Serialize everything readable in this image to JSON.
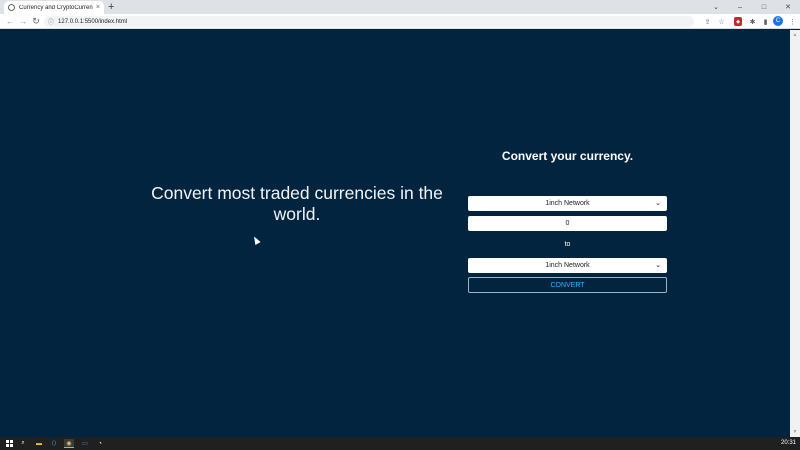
{
  "browser": {
    "tab_title": "Currency and CryptoCurrency Ex",
    "tab_close": "×",
    "new_tab": "+",
    "url": "127.0.0.1:5500/index.html",
    "lock_glyph": "ⓘ",
    "window_controls": {
      "minimize": "–",
      "maximize": "□",
      "close": "✕",
      "dropdown": "⌄"
    },
    "nav": {
      "back": "←",
      "forward": "→",
      "reload": "↻"
    },
    "toolbar_icons": {
      "share": "⇪",
      "star": "☆",
      "extension_shield": "◆",
      "puzzle": "✱",
      "sidebar": "▮",
      "profile_initial": "C",
      "menu": "⋮"
    }
  },
  "page": {
    "hero_text": "Convert most traded currencies in the world.",
    "converter": {
      "title": "Convert your currency.",
      "from_currency": "1inch Network",
      "amount_value": "0",
      "to_label": "to",
      "to_currency": "1inch Network",
      "convert_label": "CONVERT",
      "chevron": "⌄"
    },
    "colors": {
      "background": "#03243e",
      "button_text": "#29b6f6"
    }
  },
  "scrollbar": {
    "up": "▲",
    "down": "▼"
  },
  "taskbar": {
    "search_glyph": "⌕",
    "apps": [
      "file-explorer",
      "vscode",
      "browser",
      "mail",
      "clock"
    ],
    "app_glyphs": [
      "▬",
      "⟨⟩",
      "◉",
      "▭",
      "◔"
    ],
    "time": "20:31"
  }
}
